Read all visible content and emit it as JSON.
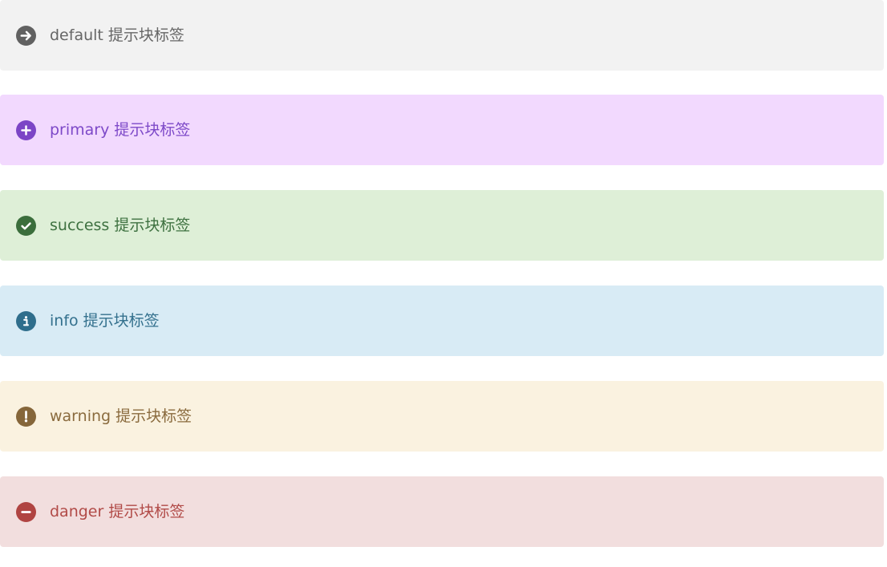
{
  "alerts": [
    {
      "variant": "default",
      "label": "default 提示块标签",
      "icon": "arrow-right-circle-icon",
      "bg": "#f2f2f2",
      "fg": "#666666",
      "icon_color": "#616161"
    },
    {
      "variant": "primary",
      "label": "primary 提示块标签",
      "icon": "plus-circle-icon",
      "bg": "#f2d9fe",
      "fg": "#7d49c8",
      "icon_color": "#7c45c6"
    },
    {
      "variant": "success",
      "label": "success 提示块标签",
      "icon": "check-circle-icon",
      "bg": "#deefd7",
      "fg": "#3e7140",
      "icon_color": "#3b6e3c"
    },
    {
      "variant": "info",
      "label": "info 提示块标签",
      "icon": "info-circle-icon",
      "bg": "#d8ebf5",
      "fg": "#33708d",
      "icon_color": "#2f6e8c"
    },
    {
      "variant": "warning",
      "label": "warning 提示块标签",
      "icon": "exclamation-circle-icon",
      "bg": "#faf2e0",
      "fg": "#8a6b3e",
      "icon_color": "#85663a"
    },
    {
      "variant": "danger",
      "label": "danger 提示块标签",
      "icon": "minus-circle-icon",
      "bg": "#f2dede",
      "fg": "#b14a47",
      "icon_color": "#b04442"
    }
  ]
}
